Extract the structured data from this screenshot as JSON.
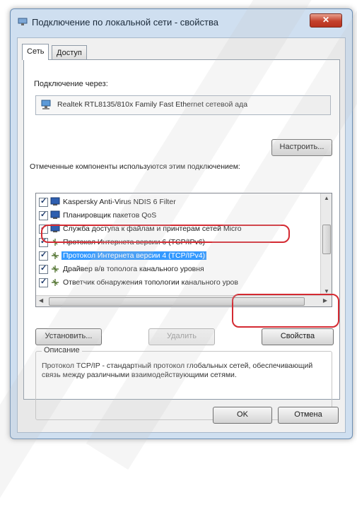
{
  "window": {
    "title": "Подключение по локальной сети - свойства",
    "close_glyph": "✕"
  },
  "tabs": [
    {
      "label": "Сеть",
      "active": true
    },
    {
      "label": "Доступ",
      "active": false
    }
  ],
  "connect_via_label": "Подключение через:",
  "adapter_name": "Realtek RTL8135/810x Family Fast Ethernet сетевой ада",
  "configure_button": "Настроить...",
  "components_label": "Отмеченные компоненты используются этим подключением:",
  "components": [
    {
      "label": "Kaspersky Anti-Virus NDIS 6 Filter",
      "checked": true,
      "icon": "network-client-icon",
      "selected": false
    },
    {
      "label": "Планировщик пакетов QoS",
      "checked": true,
      "icon": "network-client-icon",
      "selected": false
    },
    {
      "label": "Служба доступа к файлам и принтерам сетей Micro",
      "checked": true,
      "icon": "network-client-icon",
      "selected": false
    },
    {
      "label": "Протокол Интернета версии 6 (TCP/IPv6)",
      "checked": true,
      "icon": "protocol-icon",
      "selected": false
    },
    {
      "label": "Протокол Интернета версии 4 (TCP/IPv4)",
      "checked": true,
      "icon": "protocol-icon",
      "selected": true
    },
    {
      "label": "Драйвер в/в тополога канального уровня",
      "checked": true,
      "icon": "protocol-icon",
      "selected": false
    },
    {
      "label": "Ответчик обнаружения топологии канального уров",
      "checked": true,
      "icon": "protocol-icon",
      "selected": false
    }
  ],
  "install_button": "Установить...",
  "remove_button": "Удалить",
  "properties_button": "Свойства",
  "description": {
    "legend": "Описание",
    "text": "Протокол TCP/IP - стандартный протокол глобальных сетей, обеспечивающий связь между различными взаимодействующими сетями."
  },
  "ok_button": "OK",
  "cancel_button": "Отмена",
  "colors": {
    "highlight": "#3399ff",
    "annotation_red": "#d42a32",
    "frame": "#cfdff0"
  }
}
